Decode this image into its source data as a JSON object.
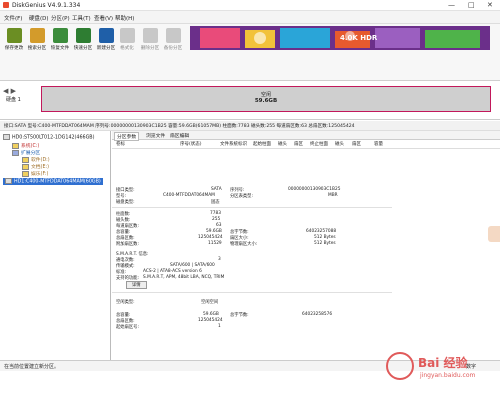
{
  "window": {
    "title": "DiskGenius V4.9.1.334",
    "controls": [
      "—",
      "□",
      "✕"
    ]
  },
  "menu": [
    "文件(F)",
    "硬盘(D)",
    "分区(P)",
    "工具(T)",
    "查看(V)",
    "帮助(H)"
  ],
  "toolbar": [
    {
      "label": "保存更改",
      "icon": "save-icon",
      "color": "#6b8e23"
    },
    {
      "label": "搜索分区",
      "icon": "search-icon",
      "color": "#d39b2b"
    },
    {
      "label": "恢复文件",
      "icon": "recover-icon",
      "color": "#3c8c3c"
    },
    {
      "label": "快速分区",
      "icon": "quick-partition-icon",
      "color": "#2e7d32"
    },
    {
      "label": "新建分区",
      "icon": "new-partition-icon",
      "color": "#1f5fa8"
    },
    {
      "label": "格式化",
      "icon": "format-icon",
      "color": "#8a8a8a"
    },
    {
      "label": "删除分区",
      "icon": "delete-partition-icon",
      "color": "#9a9a9a"
    },
    {
      "label": "备份分区",
      "icon": "backup-partition-icon",
      "color": "#9a9a9a"
    }
  ],
  "banner": {
    "text": "4.0K HDR",
    "bg": "#7a3a9a"
  },
  "disk_panel": {
    "nav_back": "◀",
    "nav_fwd": "▶",
    "disk_label": "硬盘 1",
    "partition_name": "空闲",
    "partition_size": "59.6GB",
    "border_color": "#c2185b"
  },
  "infoline": {
    "text1": "接口:SATA  型号:C400-MTFDDAT064MAM  序列号:00000000130903C1B25  容量:59.6GB(61057MB)  柱面数:7783  磁头数:255  每道扇区数:63  总扇区数:125045424"
  },
  "tree": {
    "hd0": "HD0:ST500LT012-1DG142(466GB)",
    "system": "系统(C:)",
    "extended": "扩展分区",
    "software": "软件(D:)",
    "docs": "文档(E:)",
    "entertain": "娱乐(F:)",
    "hd1": "HD1:C400-MTFDDAT064MAM(60GB)"
  },
  "tabs": [
    "分区参数",
    "浏览文件",
    "扇区编辑"
  ],
  "columns": [
    "卷标",
    "序号(状态)",
    "文件系统",
    "标识",
    "起始柱面",
    "磁头",
    "扇区",
    "终止柱面",
    "磁头",
    "扇区",
    "容量"
  ],
  "details": {
    "iface_l": "接口类型:",
    "iface_v": "SATA",
    "sn_l": "序列号:",
    "sn_v": "00000000130903C1B25",
    "model_l": "型号:",
    "model_v": "C400-MTFDDAT064MAM",
    "pt_l": "分区表类型:",
    "pt_v": "MBR",
    "media_l": "磁盘类型:",
    "media_v": "固态",
    "cyl_l": "柱面数:",
    "cyl_v": "7783",
    "heads_l": "磁头数:",
    "heads_v": "255",
    "spt_l": "每道扇区数:",
    "spt_v": "63",
    "cap_l": "总容量:",
    "cap_v": "59.6GB",
    "tb_l": "总字节数:",
    "tb_v": "64023257088",
    "ts_l": "总扇区数:",
    "ts_v": "125045424",
    "ss_l": "扇区大小:",
    "ss_v": "512 Bytes",
    "as_l": "附加扇区数:",
    "as_v": "11529",
    "ps_l": "物理扇区大小:",
    "ps_v": "512 Bytes",
    "smart_l": "S.M.A.R.T. 信息:",
    "poh_l": "通电次数:",
    "poh_v": "3",
    "ver_l": "传输模式:",
    "ver_v": "SATA/600 | SATA/600",
    "std_l": "标准:",
    "std_v": "ACS-2 | ATA8-ACS version 6",
    "feat_l": "支持的功能:",
    "feat_v": "S.M.A.R.T, APM, 48bit LBA, NCQ, TRIM",
    "detail_btn": "详情",
    "free_l": "空闲类型:",
    "free_v": "空闲空间",
    "fcap_l": "总容量:",
    "fcap_v": "59.6GB",
    "fbytes_l": "总字节数:",
    "fbytes_v": "64023258576",
    "fsec_l": "总扇区数:",
    "fsec_v": "125045424",
    "fstart_l": "起始扇区号:",
    "fstart_v": "1"
  },
  "status": {
    "left": "在当前位置建立新分区。",
    "right": "数字"
  },
  "watermark": {
    "text": "Bai 经验",
    "sub": "jingyan.baidu.com"
  }
}
